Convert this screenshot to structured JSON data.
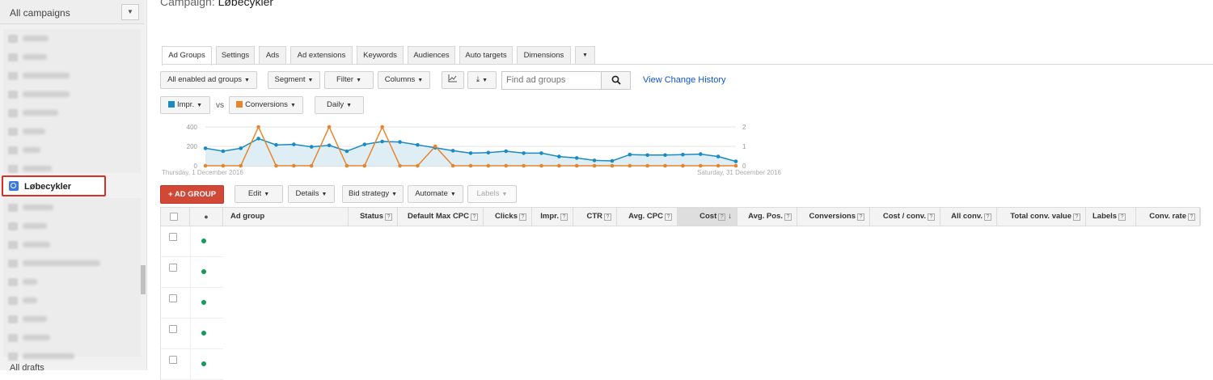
{
  "sidebar": {
    "campaign_select": "All campaigns",
    "selected_item": "Løbecykler",
    "drafts_label": "All drafts"
  },
  "header": {
    "campaign_prefix": "Campaign:",
    "campaign_name": "Løbecykler"
  },
  "tabs": [
    "Ad Groups",
    "Settings",
    "Ads",
    "Ad extensions",
    "Keywords",
    "Audiences",
    "Auto targets",
    "Dimensions"
  ],
  "toolbar": {
    "filter_status": "All enabled ad groups",
    "segment": "Segment",
    "filter": "Filter",
    "columns": "Columns",
    "search_placeholder": "Find ad groups",
    "view_change_history": "View Change History"
  },
  "metrics": {
    "metric1": "Impr.",
    "metric1_color": "#1a8bc0",
    "vs": "vs",
    "metric2": "Conversions",
    "metric2_color": "#e8842c",
    "period": "Daily"
  },
  "chart_data": {
    "type": "line",
    "x_start_label": "Thursday, 1 December 2016",
    "x_end_label": "Saturday, 31 December 2016",
    "left_ticks": [
      "400",
      "200",
      "0"
    ],
    "right_ticks": [
      "2",
      "1",
      "0"
    ],
    "left_ylim": [
      0,
      400
    ],
    "right_ylim": [
      0,
      2
    ],
    "series": [
      {
        "name": "Impr.",
        "axis": "left",
        "values": [
          180,
          150,
          180,
          280,
          215,
          220,
          195,
          210,
          150,
          220,
          250,
          245,
          215,
          185,
          155,
          130,
          135,
          150,
          130,
          130,
          95,
          80,
          55,
          50,
          115,
          110,
          110,
          115,
          120,
          95,
          45
        ]
      },
      {
        "name": "Conversions",
        "axis": "right",
        "values": [
          0,
          0,
          0,
          2,
          0,
          0,
          0,
          2,
          0,
          0,
          2,
          0,
          0,
          1,
          0,
          0,
          0,
          0,
          0,
          0,
          0,
          0,
          0,
          0,
          0,
          0,
          0,
          0,
          0,
          0,
          0
        ]
      }
    ]
  },
  "actions": {
    "add_group": "AD GROUP",
    "edit": "Edit",
    "details": "Details",
    "bid_strategy": "Bid strategy",
    "automate": "Automate",
    "labels": "Labels"
  },
  "table": {
    "columns": [
      "Ad group",
      "Status",
      "Default Max CPC",
      "Clicks",
      "Impr.",
      "CTR",
      "Avg. CPC",
      "Cost",
      "Avg. Pos.",
      "Conversions",
      "Cost / conv.",
      "All conv.",
      "Total conv. value",
      "Labels",
      "Conv. rate"
    ],
    "row_count": 5
  }
}
